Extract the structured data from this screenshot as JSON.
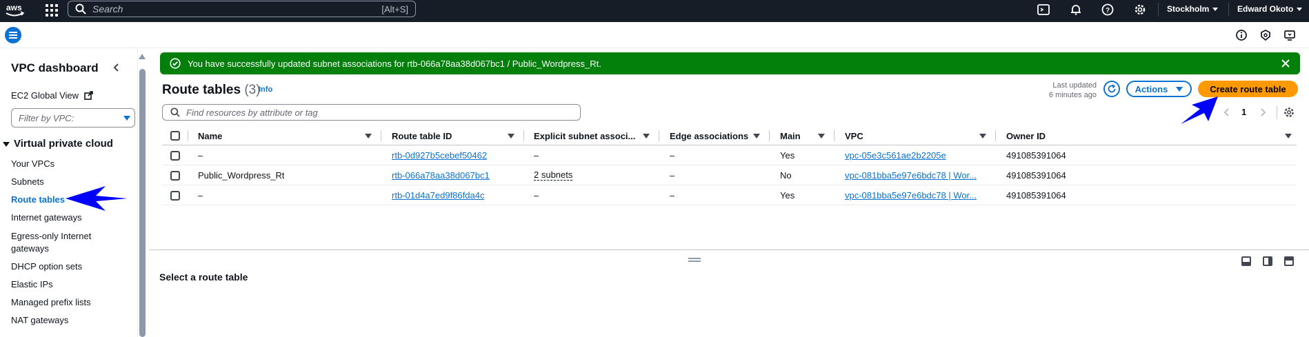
{
  "topnav": {
    "logo": "aws",
    "search_placeholder": "Search",
    "search_shortcut": "[Alt+S]",
    "region": "Stockholm",
    "user": "Edward Okoto"
  },
  "sidebar": {
    "title": "VPC dashboard",
    "ec2_global_view": "EC2 Global View",
    "filter_placeholder": "Filter by VPC:",
    "section": "Virtual private cloud",
    "items": [
      {
        "label": "Your VPCs"
      },
      {
        "label": "Subnets"
      },
      {
        "label": "Route tables"
      },
      {
        "label": "Internet gateways"
      },
      {
        "label": "Egress-only Internet gateways"
      },
      {
        "label": "DHCP option sets"
      },
      {
        "label": "Elastic IPs"
      },
      {
        "label": "Managed prefix lists"
      },
      {
        "label": "NAT gateways"
      }
    ]
  },
  "flash": {
    "message": "You have successfully updated subnet associations for rtb-066a78aa38d067bc1 / Public_Wordpress_Rt."
  },
  "header": {
    "title": "Route tables",
    "count": "(3)",
    "info": "Info",
    "last_updated_1": "Last updated",
    "last_updated_2": "6 minutes ago",
    "actions_label": "Actions",
    "create_label": "Create route table",
    "find_placeholder": "Find resources by attribute or tag",
    "page": "1"
  },
  "table": {
    "columns": [
      "Name",
      "Route table ID",
      "Explicit subnet associ...",
      "Edge associations",
      "Main",
      "VPC",
      "Owner ID"
    ],
    "rows": [
      {
        "name": "–",
        "id": "rtb-0d927b5cebef50462",
        "subnets": "–",
        "edge": "–",
        "main": "Yes",
        "vpc": "vpc-05e3c561ae2b2205e",
        "owner": "491085391064"
      },
      {
        "name": "Public_Wordpress_Rt",
        "id": "rtb-066a78aa38d067bc1",
        "subnets": "2 subnets",
        "edge": "–",
        "main": "No",
        "vpc": "vpc-081bba5e97e6bdc78 | Wor...",
        "owner": "491085391064"
      },
      {
        "name": "–",
        "id": "rtb-01d4a7ed9f86fda4c",
        "subnets": "–",
        "edge": "–",
        "main": "Yes",
        "vpc": "vpc-081bba5e97e6bdc78 | Wor...",
        "owner": "491085391064"
      }
    ]
  },
  "split_panel": {
    "title": "Select a route table"
  },
  "colors": {
    "nav_bg": "#161d26",
    "link": "#0972d3",
    "success": "#037f0c",
    "primary_button": "#ff9900",
    "annotation_arrow": "#0000ff"
  }
}
